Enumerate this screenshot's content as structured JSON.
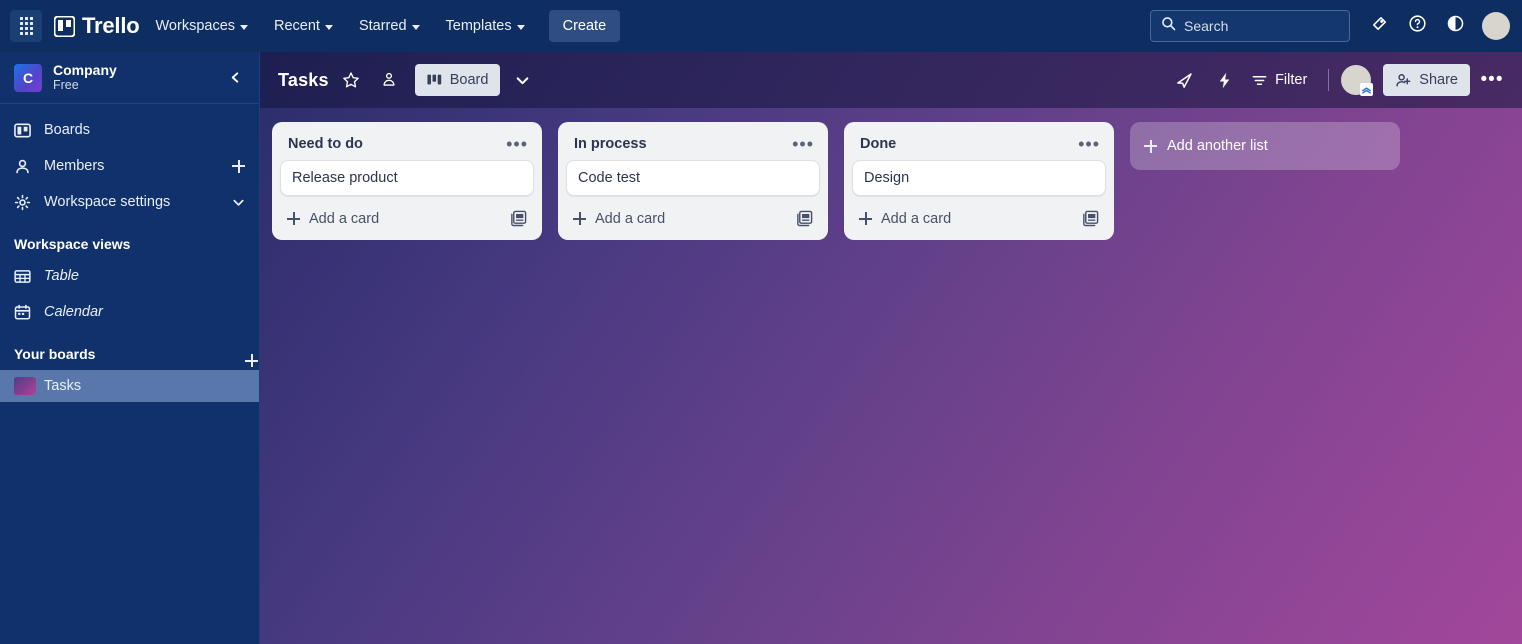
{
  "topnav": {
    "app_switcher": "app-grid",
    "brand": "Trello",
    "menus": [
      {
        "label": "Workspaces"
      },
      {
        "label": "Recent"
      },
      {
        "label": "Starred"
      },
      {
        "label": "Templates"
      }
    ],
    "create_label": "Create",
    "search_placeholder": "Search",
    "icons": [
      "notification-bell-icon",
      "help-icon",
      "theme-toggle-icon"
    ]
  },
  "sidebar": {
    "workspace": {
      "initial": "C",
      "name": "Company",
      "plan": "Free",
      "collapse": "collapse-sidebar"
    },
    "items": [
      {
        "label": "Boards",
        "icon": "boards-icon",
        "trailing": "none"
      },
      {
        "label": "Members",
        "icon": "members-icon",
        "trailing": "plus"
      },
      {
        "label": "Workspace settings",
        "icon": "gear-icon",
        "trailing": "chevron"
      }
    ],
    "views_section": "Workspace views",
    "views": [
      {
        "label": "Table",
        "icon": "table-icon"
      },
      {
        "label": "Calendar",
        "icon": "calendar-icon"
      }
    ],
    "boards_section": "Your boards",
    "boards": [
      {
        "label": "Tasks",
        "selected": true
      }
    ]
  },
  "board": {
    "title": "Tasks",
    "star": "star-icon",
    "visibility": "workspace-visible-icon",
    "view_label": "Board",
    "filter_label": "Filter",
    "share_label": "Share",
    "more_label": "•••",
    "rocket": "rocket-icon",
    "automation": "lightning-icon"
  },
  "lists": [
    {
      "title": "Need to do",
      "cards": [
        {
          "title": "Release product"
        }
      ],
      "add_card_label": "Add a card"
    },
    {
      "title": "In process",
      "cards": [
        {
          "title": "Code test"
        }
      ],
      "add_card_label": "Add a card"
    },
    {
      "title": "Done",
      "cards": [
        {
          "title": "Design"
        }
      ],
      "add_card_label": "Add a card"
    }
  ],
  "add_list_label": "Add another list",
  "colors": {
    "topnav": "#0e2d61",
    "sidebar": "#10316b",
    "board_gradient_start": "#2a2d6b",
    "board_gradient_end": "#a2479b",
    "list_bg": "#f1f2f4",
    "card_bg": "#ffffff"
  }
}
